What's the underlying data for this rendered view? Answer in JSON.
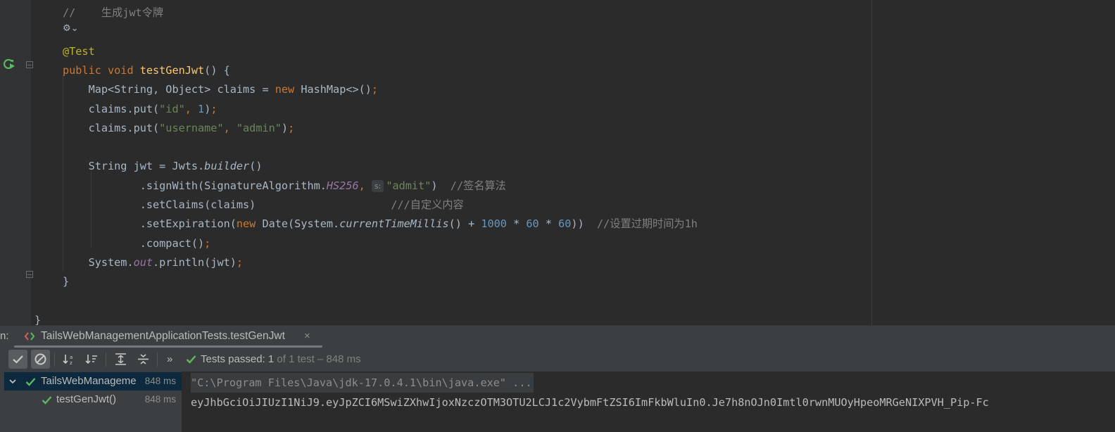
{
  "editor": {
    "lines": [
      [
        {
          "t": "//    生成jwt令牌",
          "c": "c-cmt"
        }
      ],
      [],
      [
        {
          "t": "@Test",
          "c": "c-ann"
        }
      ],
      [
        {
          "t": "public ",
          "c": "c-kw"
        },
        {
          "t": "void ",
          "c": "c-kw"
        },
        {
          "t": "testGenJwt",
          "c": "c-fn"
        },
        {
          "t": "() {",
          "c": ""
        }
      ],
      [
        {
          "t": "    Map<String, Object> claims = ",
          "c": ""
        },
        {
          "t": "new ",
          "c": "c-kw"
        },
        {
          "t": "HashMap<>()",
          "c": ""
        },
        {
          "t": ";",
          "c": "c-sc"
        }
      ],
      [
        {
          "t": "    claims.put(",
          "c": ""
        },
        {
          "t": "\"id\"",
          "c": "c-str"
        },
        {
          "t": ", ",
          "c": "c-sc"
        },
        {
          "t": "1",
          "c": "c-num"
        },
        {
          "t": ")",
          "c": ""
        },
        {
          "t": ";",
          "c": "c-sc"
        }
      ],
      [
        {
          "t": "    claims.put(",
          "c": ""
        },
        {
          "t": "\"username\"",
          "c": "c-str"
        },
        {
          "t": ", ",
          "c": "c-sc"
        },
        {
          "t": "\"admin\"",
          "c": "c-str"
        },
        {
          "t": ")",
          "c": ""
        },
        {
          "t": ";",
          "c": "c-sc"
        }
      ],
      [],
      [
        {
          "t": "    String jwt = Jwts.",
          "c": ""
        },
        {
          "t": "builder",
          "c": "c-it"
        },
        {
          "t": "()",
          "c": ""
        }
      ],
      [
        {
          "t": "            .signWith(SignatureAlgorithm.",
          "c": ""
        },
        {
          "t": "HS256",
          "c": "c-sf"
        },
        {
          "t": ", ",
          "c": "c-sc"
        },
        {
          "t": "s:",
          "c": "hint"
        },
        {
          "t": "\"admit\"",
          "c": "c-str"
        },
        {
          "t": ")  ",
          "c": ""
        },
        {
          "t": "//签名算法",
          "c": "c-cmt"
        }
      ],
      [
        {
          "t": "            .setClaims(claims)                     ",
          "c": ""
        },
        {
          "t": "///自定义内容",
          "c": "c-cmt"
        }
      ],
      [
        {
          "t": "            .setExpiration(",
          "c": ""
        },
        {
          "t": "new ",
          "c": "c-kw"
        },
        {
          "t": "Date(System.",
          "c": ""
        },
        {
          "t": "currentTimeMillis",
          "c": "c-it"
        },
        {
          "t": "() + ",
          "c": ""
        },
        {
          "t": "1000",
          "c": "c-num"
        },
        {
          "t": " * ",
          "c": ""
        },
        {
          "t": "60",
          "c": "c-num"
        },
        {
          "t": " * ",
          "c": ""
        },
        {
          "t": "60",
          "c": "c-num"
        },
        {
          "t": "))  ",
          "c": ""
        },
        {
          "t": "//设置过期时间为1h",
          "c": "c-cmt"
        }
      ],
      [
        {
          "t": "            .compact()",
          "c": ""
        },
        {
          "t": ";",
          "c": "c-sc"
        }
      ],
      [
        {
          "t": "    System.",
          "c": ""
        },
        {
          "t": "out",
          "c": "c-sf"
        },
        {
          "t": ".println(jwt)",
          "c": ""
        },
        {
          "t": ";",
          "c": "c-sc"
        }
      ],
      [
        {
          "t": "}",
          "c": ""
        }
      ],
      [],
      [
        {
          "t": "}",
          "c": ""
        }
      ]
    ]
  },
  "run_panel": {
    "prefix": "n:",
    "tab_label": "TailsWebManagementApplicationTests.testGenJwt",
    "tab_close": "×",
    "status": {
      "passed_label": "Tests passed: ",
      "passed_count": "1",
      "of_total": " of 1 test – 848 ms"
    },
    "more_icon": "»",
    "tree": [
      {
        "label": "TailsWebManageme",
        "time": "848 ms"
      },
      {
        "label": "testGenJwt()",
        "time": "848 ms"
      }
    ],
    "console": [
      "\"C:\\Program Files\\Java\\jdk-17.0.4.1\\bin\\java.exe\" ...",
      "eyJhbGciOiJIUzI1NiJ9.eyJpZCI6MSwiZXhwIjoxNzczOTM3OTU2LCJ1c2VybmFtZSI6ImFkbWluIn0.Je7h8nOJn0Imtl0rwnMUOyHpeoMRGeNIXPVH_Pip-Fc"
    ]
  },
  "colors": {
    "success": "#5fb760",
    "keyword": "#cc7832",
    "string": "#6a8759",
    "number": "#6897bb"
  }
}
